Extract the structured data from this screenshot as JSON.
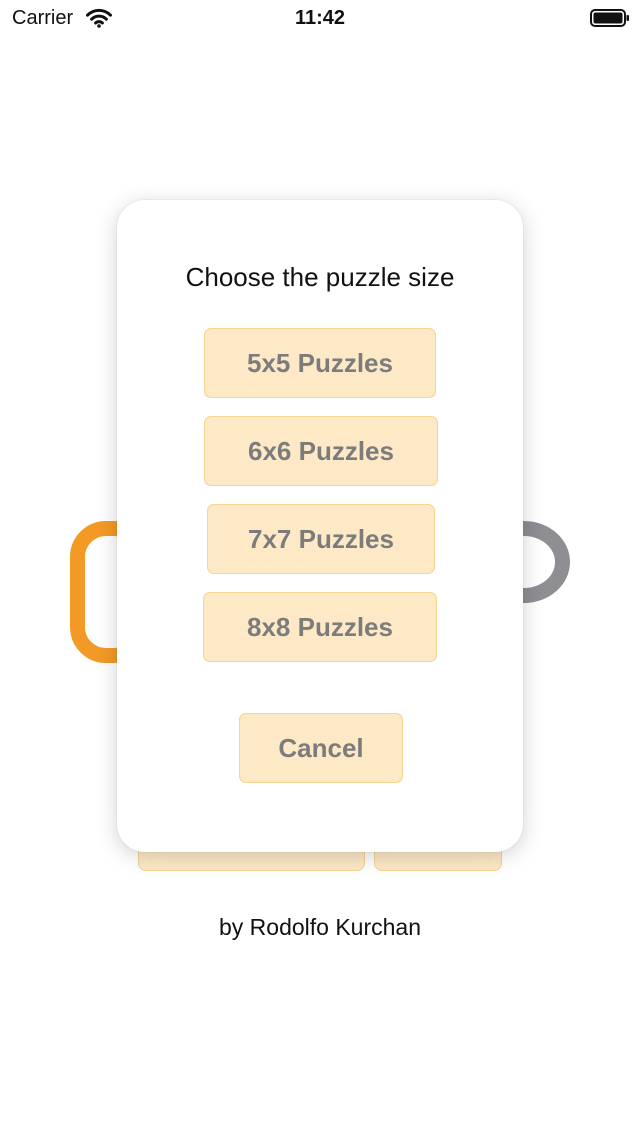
{
  "status_bar": {
    "carrier": "Carrier",
    "time": "11:42"
  },
  "dialog": {
    "title": "Choose the puzzle size",
    "options": [
      {
        "label": "5x5 Puzzles"
      },
      {
        "label": "6x6 Puzzles"
      },
      {
        "label": "7x7 Puzzles"
      },
      {
        "label": "8x8 Puzzles"
      }
    ],
    "cancel_label": "Cancel"
  },
  "footer": {
    "credit": "by Rodolfo Kurchan"
  },
  "colors": {
    "button_fill": "#fde9c6",
    "button_border": "#f6d38e",
    "button_text": "#7c7c7c",
    "accent_orange": "#f39a26",
    "accent_gray": "#8e8e93"
  }
}
